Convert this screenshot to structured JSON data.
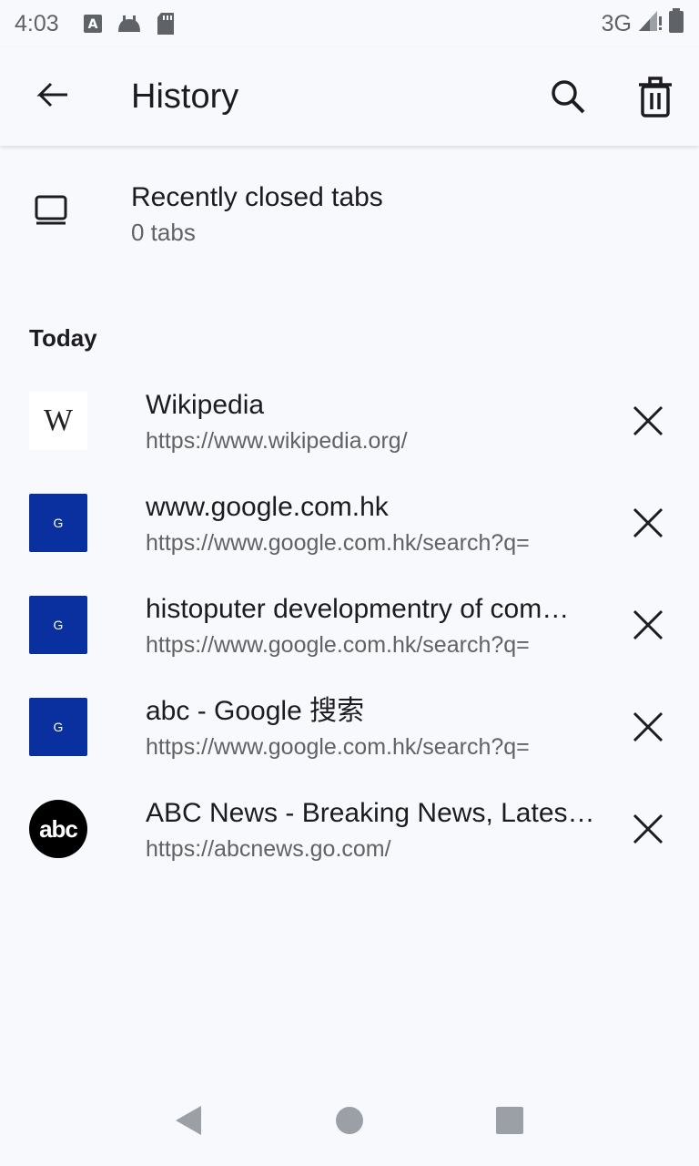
{
  "status_bar": {
    "time": "4:03",
    "network": "3G",
    "icons": [
      "a11y-icon",
      "android-icon",
      "sd-card-icon",
      "signal-icon",
      "battery-icon"
    ]
  },
  "app_bar": {
    "title": "History",
    "icons": [
      "back-arrow-icon",
      "search-icon",
      "trash-icon"
    ]
  },
  "recently_closed": {
    "label": "Recently closed tabs",
    "count_text": "0 tabs"
  },
  "section": {
    "title": "Today"
  },
  "history": [
    {
      "title": "Wikipedia",
      "url": "https://www.wikipedia.org/",
      "favicon_text": "W",
      "favicon": "wikipedia"
    },
    {
      "title": "www.google.com.hk",
      "url": "https://www.google.com.hk/search?q=",
      "favicon_text": "G",
      "favicon": "google"
    },
    {
      "title": "histoputer developmentry of com…",
      "url": "https://www.google.com.hk/search?q=",
      "favicon_text": "G",
      "favicon": "google"
    },
    {
      "title": "abc - Google 搜索",
      "url": "https://www.google.com.hk/search?q=",
      "favicon_text": "G",
      "favicon": "google"
    },
    {
      "title": "ABC News - Breaking News, Latest News",
      "url": "https://abcnews.go.com/",
      "favicon_text": "abc",
      "favicon": "abc"
    }
  ],
  "colors": {
    "background": "#f8f9fc",
    "google_favicon": "#0a2f9e",
    "secondary_text": "#5f6368"
  }
}
